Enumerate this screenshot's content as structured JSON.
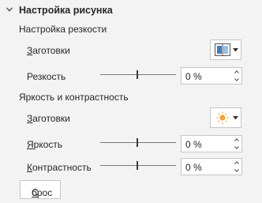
{
  "panel": {
    "title": "Настройка рисунка",
    "sharpness": {
      "title": "Настройка резкости",
      "presets_label_u": "З",
      "presets_label_rest": "аготовки",
      "sharpness_label": "Резкость",
      "sharpness_value": "0 %"
    },
    "brightness_contrast": {
      "title": "Яркость и контрастность",
      "presets_label_u": "З",
      "presets_label_rest": "аготовки",
      "brightness_label_u": "Я",
      "brightness_label_rest": "ркость",
      "brightness_value": "0 %",
      "contrast_label_u": "К",
      "contrast_label_rest": "онтрастность",
      "contrast_value": "0 %"
    },
    "reset_u": "С",
    "reset_rest": "брос"
  },
  "icons": {
    "collapse": "chevron-down-icon",
    "sharpness_preset": "sharpness-preset-icon",
    "brightness_preset": "sun-icon",
    "dropdown": "caret-down-icon",
    "spin_up": "spin-up-icon",
    "spin_down": "spin-down-icon"
  },
  "colors": {
    "background": "#f3f3f3",
    "text": "#262626",
    "sun": "#f2a33a"
  }
}
